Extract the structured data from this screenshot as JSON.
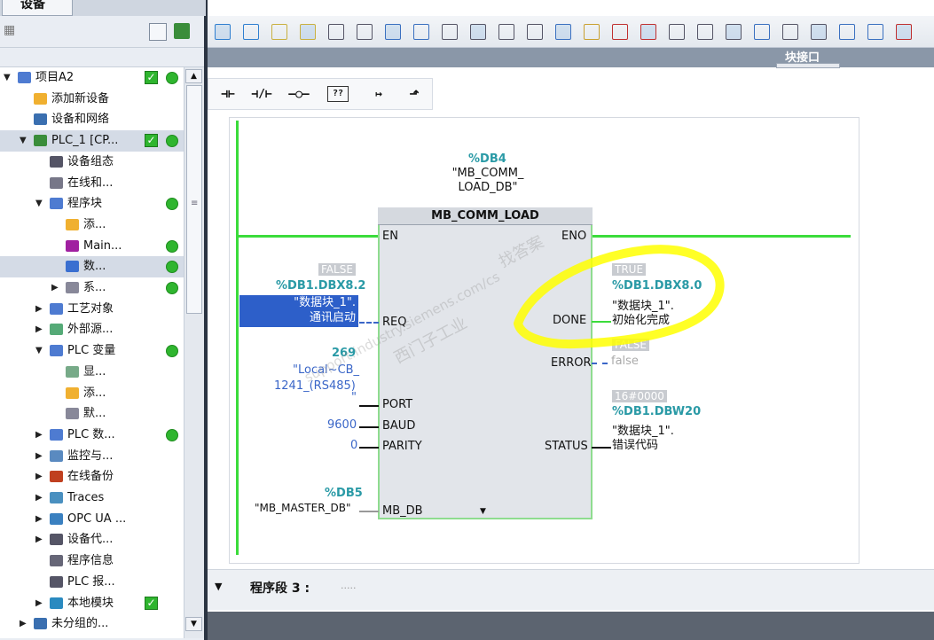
{
  "left_panel": {
    "tab_label": "设备",
    "tree": [
      {
        "label": "项目A2",
        "indent": 0,
        "expand": "open",
        "icon": "project-icon",
        "check": true,
        "dot": true,
        "selected": false
      },
      {
        "label": "添加新设备",
        "indent": 1,
        "expand": "",
        "icon": "add-device-icon",
        "check": false,
        "dot": false,
        "selected": false
      },
      {
        "label": "设备和网络",
        "indent": 1,
        "expand": "",
        "icon": "network-icon",
        "check": false,
        "dot": false,
        "selected": false
      },
      {
        "label": "PLC_1 [CP...",
        "indent": 1,
        "expand": "open",
        "icon": "plc-icon",
        "check": true,
        "dot": true,
        "selected": true
      },
      {
        "label": "设备组态",
        "indent": 2,
        "expand": "",
        "icon": "device-config-icon",
        "check": false,
        "dot": false,
        "selected": false
      },
      {
        "label": "在线和...",
        "indent": 2,
        "expand": "",
        "icon": "online-diag-icon",
        "check": false,
        "dot": false,
        "selected": false
      },
      {
        "label": "程序块",
        "indent": 2,
        "expand": "open",
        "icon": "program-blocks-icon",
        "check": false,
        "dot": true,
        "selected": false
      },
      {
        "label": "添...",
        "indent": 3,
        "expand": "",
        "icon": "add-block-icon",
        "check": false,
        "dot": false,
        "selected": false
      },
      {
        "label": "Main...",
        "indent": 3,
        "expand": "",
        "icon": "ob-icon",
        "check": false,
        "dot": true,
        "selected": false
      },
      {
        "label": "数...",
        "indent": 3,
        "expand": "",
        "icon": "db-icon",
        "check": false,
        "dot": true,
        "selected": true
      },
      {
        "label": "系...",
        "indent": 3,
        "expand": "closed",
        "icon": "system-blocks-icon",
        "check": false,
        "dot": true,
        "selected": false
      },
      {
        "label": "工艺对象",
        "indent": 2,
        "expand": "closed",
        "icon": "tech-objects-icon",
        "check": false,
        "dot": false,
        "selected": false
      },
      {
        "label": "外部源...",
        "indent": 2,
        "expand": "closed",
        "icon": "external-source-icon",
        "check": false,
        "dot": false,
        "selected": false
      },
      {
        "label": "PLC 变量",
        "indent": 2,
        "expand": "open",
        "icon": "plc-tags-icon",
        "check": false,
        "dot": true,
        "selected": false
      },
      {
        "label": "显...",
        "indent": 3,
        "expand": "",
        "icon": "show-tags-icon",
        "check": false,
        "dot": false,
        "selected": false
      },
      {
        "label": "添...",
        "indent": 3,
        "expand": "",
        "icon": "add-table-icon",
        "check": false,
        "dot": false,
        "selected": false
      },
      {
        "label": "默...",
        "indent": 3,
        "expand": "",
        "icon": "default-table-icon",
        "check": false,
        "dot": false,
        "selected": false
      },
      {
        "label": "PLC 数...",
        "indent": 2,
        "expand": "closed",
        "icon": "plc-datatypes-icon",
        "check": false,
        "dot": true,
        "selected": false
      },
      {
        "label": "监控与...",
        "indent": 2,
        "expand": "closed",
        "icon": "watch-tables-icon",
        "check": false,
        "dot": false,
        "selected": false
      },
      {
        "label": "在线备份",
        "indent": 2,
        "expand": "closed",
        "icon": "online-backup-icon",
        "check": false,
        "dot": false,
        "selected": false
      },
      {
        "label": "Traces",
        "indent": 2,
        "expand": "closed",
        "icon": "traces-icon",
        "check": false,
        "dot": false,
        "selected": false
      },
      {
        "label": "OPC UA ...",
        "indent": 2,
        "expand": "closed",
        "icon": "opcua-icon",
        "check": false,
        "dot": false,
        "selected": false
      },
      {
        "label": "设备代...",
        "indent": 2,
        "expand": "closed",
        "icon": "device-proxy-icon",
        "check": false,
        "dot": false,
        "selected": false
      },
      {
        "label": "程序信息",
        "indent": 2,
        "expand": "",
        "icon": "program-info-icon",
        "check": false,
        "dot": false,
        "selected": false
      },
      {
        "label": "PLC 报...",
        "indent": 2,
        "expand": "",
        "icon": "plc-alarms-icon",
        "check": false,
        "dot": false,
        "selected": false
      },
      {
        "label": "本地模块",
        "indent": 2,
        "expand": "closed",
        "icon": "local-modules-icon",
        "check": true,
        "dot": false,
        "selected": false
      },
      {
        "label": "未分组的...",
        "indent": 1,
        "expand": "closed",
        "icon": "ungrouped-devices-icon",
        "check": false,
        "dot": false,
        "selected": false
      }
    ]
  },
  "editor": {
    "block_interface_label": "块接口",
    "instance_db": {
      "address": "%DB4",
      "name": "\"MB_COMM_\nLOAD_DB\""
    },
    "fb_name": "MB_COMM_LOAD",
    "pins": {
      "en": "EN",
      "eno": "ENO",
      "req": "REQ",
      "port": "PORT",
      "baud": "BAUD",
      "parity": "PARITY",
      "mb_db": "MB_DB",
      "done": "DONE",
      "error": "ERROR",
      "status": "STATUS"
    },
    "req_input": {
      "monitor": "FALSE",
      "address": "%DB1.DBX8.2",
      "name_line1": "\"数据块_1\".",
      "name_line2": "通讯启动"
    },
    "port_input": {
      "value": "269",
      "name_line1": "\"Local~CB_",
      "name_line2": "1241_(RS485)",
      "name_line3": "\""
    },
    "baud_input": {
      "value": "9600"
    },
    "parity_input": {
      "value": "0"
    },
    "mb_db_input": {
      "address": "%DB5",
      "name": "\"MB_MASTER_DB\""
    },
    "done_output": {
      "monitor": "TRUE",
      "address": "%DB1.DBX8.0",
      "name_line1": "\"数据块_1\".",
      "name_line2": "初始化完成"
    },
    "error_output": {
      "monitor": "FALSE",
      "value": "false"
    },
    "status_output": {
      "monitor": "16#0000",
      "address": "%DB1.DBW20",
      "name_line1": "\"数据块_1\".",
      "name_line2": "错误代码"
    },
    "segment3": {
      "label": "程序段 3 :",
      "comment": "....."
    },
    "watermark": [
      "找答案",
      "support.industry.siemens.com/cs",
      "西门子工业"
    ]
  },
  "colors": {
    "power_flow": "#3bdc3b",
    "highlight": "#ffff00",
    "selection": "#2d5fc9",
    "db_address": "#2a9aa6"
  }
}
